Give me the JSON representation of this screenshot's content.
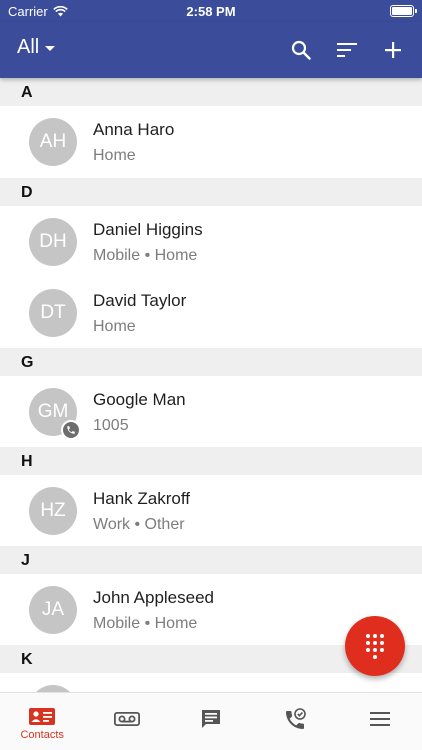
{
  "status_bar": {
    "carrier": "Carrier",
    "time": "2:58 PM"
  },
  "app_bar": {
    "filter_label": "All"
  },
  "sections": [
    {
      "letter": "A",
      "contacts": [
        {
          "initials": "AH",
          "name": "Anna Haro",
          "sub": "Home"
        }
      ]
    },
    {
      "letter": "D",
      "contacts": [
        {
          "initials": "DH",
          "name": "Daniel Higgins",
          "sub": "Mobile • Home"
        },
        {
          "initials": "DT",
          "name": "David Taylor",
          "sub": "Home"
        }
      ]
    },
    {
      "letter": "G",
      "contacts": [
        {
          "initials": "GM",
          "name": "Google Man",
          "sub": "1005"
        }
      ]
    },
    {
      "letter": "H",
      "contacts": [
        {
          "initials": "HZ",
          "name": "Hank Zakroff",
          "sub": "Work • Other"
        }
      ]
    },
    {
      "letter": "J",
      "contacts": [
        {
          "initials": "JA",
          "name": "John Appleseed",
          "sub": "Mobile • Home"
        }
      ]
    },
    {
      "letter": "K"
    }
  ],
  "tabs": [
    {
      "label": "Contacts",
      "active": true
    }
  ],
  "colors": {
    "app_bar": "#3b4d9a",
    "accent": "#e02e1e",
    "avatar": "#c5c5c5"
  }
}
